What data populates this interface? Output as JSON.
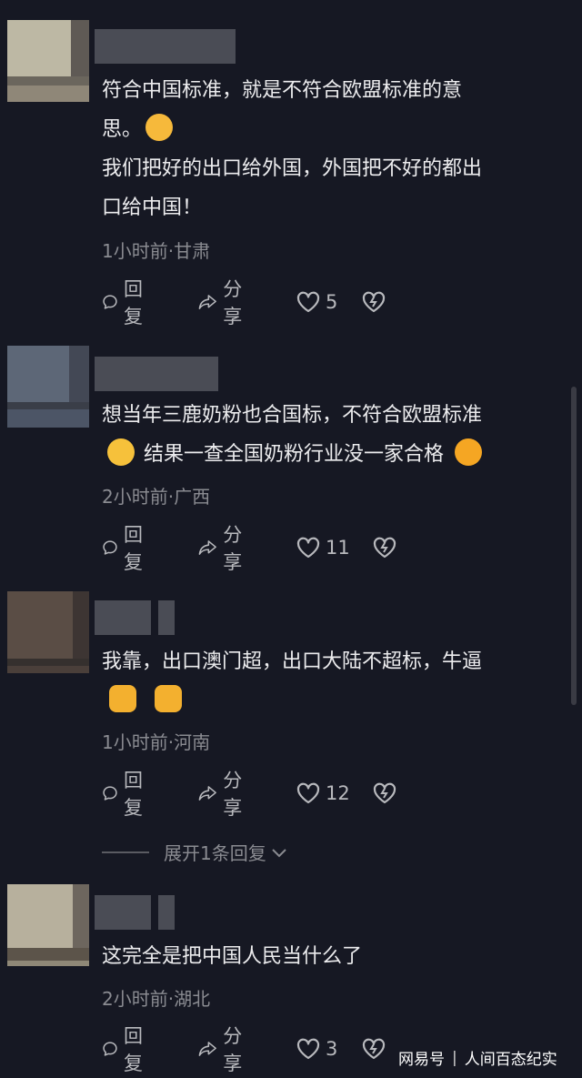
{
  "comments": [
    {
      "lines": [
        "符合中国标准，就是不符合欧盟标准的意",
        "思。",
        "我们把好的出口给外国，外国把不好的都出",
        "口给中国！"
      ],
      "time_location": "1小时前·甘肃",
      "reply_label": "回复",
      "share_label": "分享",
      "like_count": "5"
    },
    {
      "lines": [
        "想当年三鹿奶粉也合国标，不符合欧盟标准",
        "结果一查全国奶粉行业没一家合格"
      ],
      "time_location": "2小时前·广西",
      "reply_label": "回复",
      "share_label": "分享",
      "like_count": "11"
    },
    {
      "lines": [
        "我靠，出口澳门超，出口大陆不超标，牛逼"
      ],
      "time_location": "1小时前·河南",
      "reply_label": "回复",
      "share_label": "分享",
      "like_count": "12"
    },
    {
      "lines": [
        "这完全是把中国人民当什么了"
      ],
      "time_location": "2小时前·湖北",
      "reply_label": "回复",
      "share_label": "分享",
      "like_count": "3"
    }
  ],
  "expand_replies": "展开1条回复",
  "watermark": {
    "brand": "网易号",
    "author": "人间百态纪实"
  },
  "emojis": [
    "laughing-crying-emoji",
    "thinking-emoji",
    "shocked-emoji",
    "thumbs-up-emoji",
    "thumbs-up-emoji"
  ],
  "colors": {
    "background": "#161823",
    "text": "#ececee",
    "meta": "#8a8b91",
    "action": "#b8b9bd"
  }
}
